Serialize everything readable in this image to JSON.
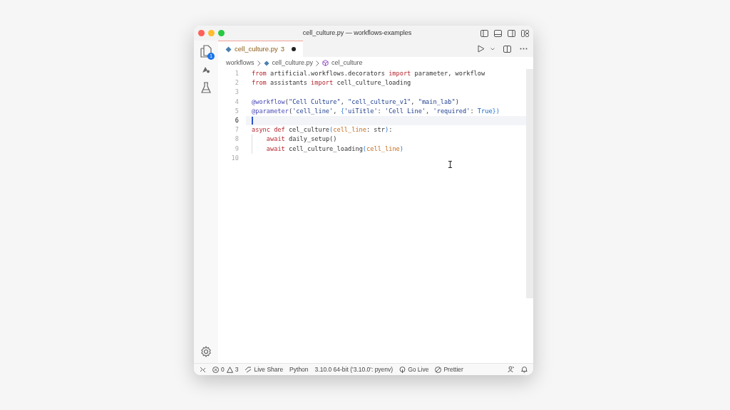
{
  "window": {
    "title": "cell_culture.py — workflows-examples"
  },
  "activity_bar": {
    "explorer_badge": "1"
  },
  "tab": {
    "label": "cell_culture.py",
    "problems": "3",
    "modified": true,
    "selected": true
  },
  "breadcrumbs": [
    "workflows",
    "cell_culture.py",
    "cel_culture"
  ],
  "editor": {
    "lines": [
      {
        "number": "1",
        "current": false,
        "tokens": [
          {
            "text": "from",
            "kind": "keyword"
          },
          {
            "text": " artificial.workflows.decorators ",
            "kind": "plain"
          },
          {
            "text": "import",
            "kind": "keyword"
          },
          {
            "text": " parameter, workflow",
            "kind": "plain"
          }
        ]
      },
      {
        "number": "2",
        "current": false,
        "tokens": [
          {
            "text": "from",
            "kind": "keyword"
          },
          {
            "text": " assistants ",
            "kind": "plain"
          },
          {
            "text": "import",
            "kind": "keyword"
          },
          {
            "text": " cell_culture_loading",
            "kind": "plain"
          }
        ]
      },
      {
        "number": "3",
        "current": false
      },
      {
        "number": "4",
        "current": false,
        "tokens": [
          {
            "text": "@workflow",
            "kind": "decorator"
          },
          {
            "text": "(",
            "kind": "plain"
          },
          {
            "text": "\"Cell Culture\"",
            "kind": "string"
          },
          {
            "text": ", ",
            "kind": "plain"
          },
          {
            "text": "\"cell_culture_v1\"",
            "kind": "string"
          },
          {
            "text": ", ",
            "kind": "plain"
          },
          {
            "text": "\"main_lab\"",
            "kind": "string"
          },
          {
            "text": ")",
            "kind": "plain"
          }
        ]
      },
      {
        "number": "5",
        "current": false,
        "tokens": [
          {
            "text": "@parameter",
            "kind": "decorator"
          },
          {
            "text": "(",
            "kind": "plain"
          },
          {
            "text": "'cell_line'",
            "kind": "string"
          },
          {
            "text": ", ",
            "kind": "plain"
          },
          {
            "text": "{",
            "kind": "bracket"
          },
          {
            "text": "'uiTitle'",
            "kind": "string"
          },
          {
            "text": ": ",
            "kind": "plain"
          },
          {
            "text": "'Cell Line'",
            "kind": "string"
          },
          {
            "text": ", ",
            "kind": "plain"
          },
          {
            "text": "'required'",
            "kind": "string"
          },
          {
            "text": ": ",
            "kind": "plain"
          },
          {
            "text": "True",
            "kind": "constant"
          },
          {
            "text": "})",
            "kind": "bracket"
          }
        ]
      },
      {
        "number": "6",
        "current": true
      },
      {
        "number": "7",
        "current": false,
        "tokens": [
          {
            "text": "async def",
            "kind": "keyword"
          },
          {
            "text": " cel_culture",
            "kind": "plain"
          },
          {
            "text": "(",
            "kind": "bracket"
          },
          {
            "text": "cell_line",
            "kind": "param"
          },
          {
            "text": ": str",
            "kind": "plain"
          },
          {
            "text": ")",
            "kind": "bracket"
          },
          {
            "text": ":",
            "kind": "plain"
          }
        ]
      },
      {
        "number": "8",
        "current": false,
        "indented": true,
        "tokens": [
          {
            "text": "await",
            "kind": "keyword"
          },
          {
            "text": " daily_setup()",
            "kind": "plain"
          }
        ]
      },
      {
        "number": "9",
        "current": false,
        "indented": true,
        "tokens": [
          {
            "text": "await",
            "kind": "keyword"
          },
          {
            "text": " cell_culture_loading",
            "kind": "plain"
          },
          {
            "text": "(",
            "kind": "bracket"
          },
          {
            "text": "cell_line",
            "kind": "param"
          },
          {
            "text": ")",
            "kind": "bracket"
          }
        ]
      },
      {
        "number": "10",
        "current": false
      }
    ]
  },
  "status_bar": {
    "errors": "0",
    "warnings": "3",
    "items": [
      "Live Share",
      "Python",
      "3.10.0 64-bit ('3.10.0': pyenv)",
      "Go Live",
      "Prettier"
    ]
  }
}
